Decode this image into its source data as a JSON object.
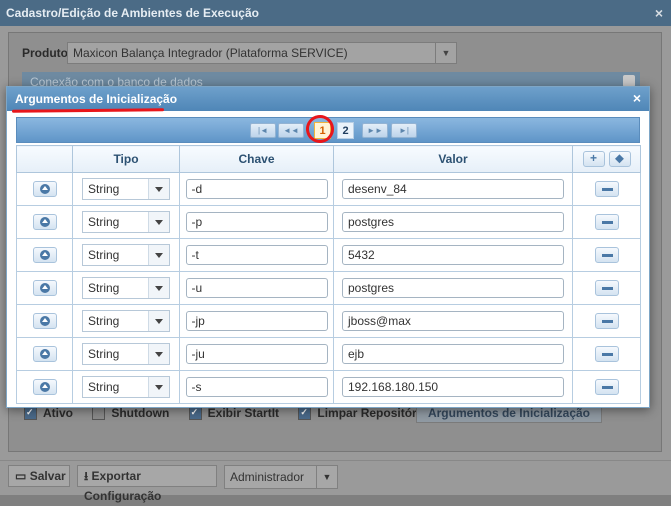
{
  "outer": {
    "title": "Cadastro/Edição de Ambientes de Execução",
    "close_icon": "×",
    "produto_label": "Produto:",
    "produto_value": "Maxicon Balança Integrador (Plataforma SERVICE)",
    "connection_panel": "Conexão com o banco de dados",
    "checkboxes": [
      {
        "label": "Ativo",
        "checked": true
      },
      {
        "label": "Shutdown",
        "checked": false
      },
      {
        "label": "Exibir StartIt",
        "checked": true
      },
      {
        "label": "Limpar Repositório",
        "checked": true
      }
    ],
    "args_button": "Argumentos de Inicialização",
    "bottom": {
      "save": "Salvar",
      "export": "Exportar Configuração",
      "role": "Administrador"
    }
  },
  "modal": {
    "title": "Argumentos de Inicialização",
    "close_icon": "×",
    "pager": {
      "first": "|◄",
      "prev": "◄◄",
      "pages": [
        "1",
        "2"
      ],
      "current": "1",
      "next": "►►",
      "last": "►|"
    },
    "columns": {
      "tipo": "Tipo",
      "chave": "Chave",
      "valor": "Valor"
    },
    "header_buttons": {
      "add": "+",
      "tag_icon": "tag-icon"
    },
    "rows": [
      {
        "tipo": "String",
        "chave": "-d",
        "valor": "desenv_84"
      },
      {
        "tipo": "String",
        "chave": "-p",
        "valor": "postgres"
      },
      {
        "tipo": "String",
        "chave": "-t",
        "valor": "5432"
      },
      {
        "tipo": "String",
        "chave": "-u",
        "valor": "postgres"
      },
      {
        "tipo": "String",
        "chave": "-jp",
        "valor": "jboss@max"
      },
      {
        "tipo": "String",
        "chave": "-ju",
        "valor": "ejb"
      },
      {
        "tipo": "String",
        "chave": "-s",
        "valor": "192.168.180.150"
      }
    ]
  },
  "colors": {
    "modal_header": "#5a8fc0",
    "annotation_red": "#e8161b",
    "active_page": "#d45f00"
  }
}
